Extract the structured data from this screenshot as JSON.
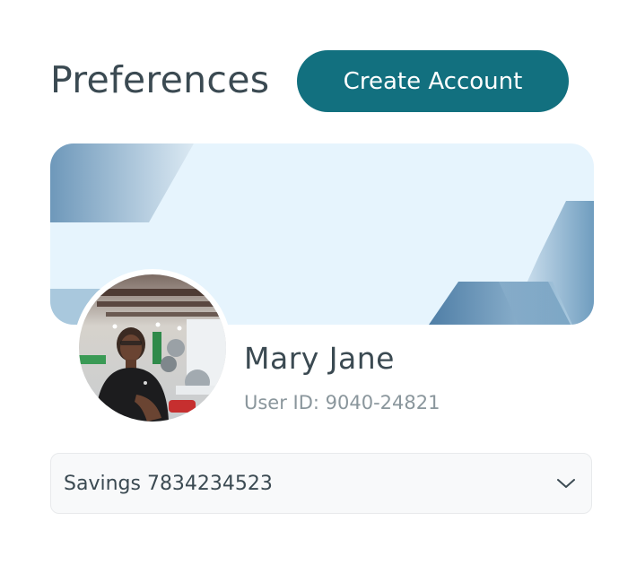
{
  "header": {
    "title": "Preferences",
    "create_account_label": "Create Account"
  },
  "profile": {
    "name": "Mary Jane",
    "user_id": "User ID: 9040-24821"
  },
  "account_select": {
    "selected": "Savings 7834234523",
    "icon": "chevron-down-icon"
  },
  "colors": {
    "primary": "#12707F",
    "heading": "#3B4A52",
    "muted": "#8A969C",
    "banner_bg": "#E6F4FD"
  }
}
